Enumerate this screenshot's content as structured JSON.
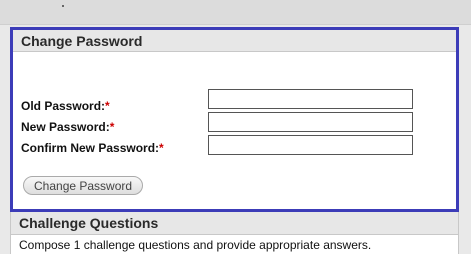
{
  "change_password": {
    "title": "Change Password",
    "fields": [
      {
        "label": "Old Password:",
        "required_marker": "*",
        "value": ""
      },
      {
        "label": "New Password:",
        "required_marker": "*",
        "value": ""
      },
      {
        "label": "Confirm New Password:",
        "required_marker": "*",
        "value": ""
      }
    ],
    "submit_label": "Change Password"
  },
  "challenge_questions": {
    "title": "Challenge Questions",
    "instruction": "Compose 1 challenge questions and provide appropriate answers."
  },
  "colors": {
    "highlight_border": "#3c3cb8",
    "required": "#cc0000"
  }
}
